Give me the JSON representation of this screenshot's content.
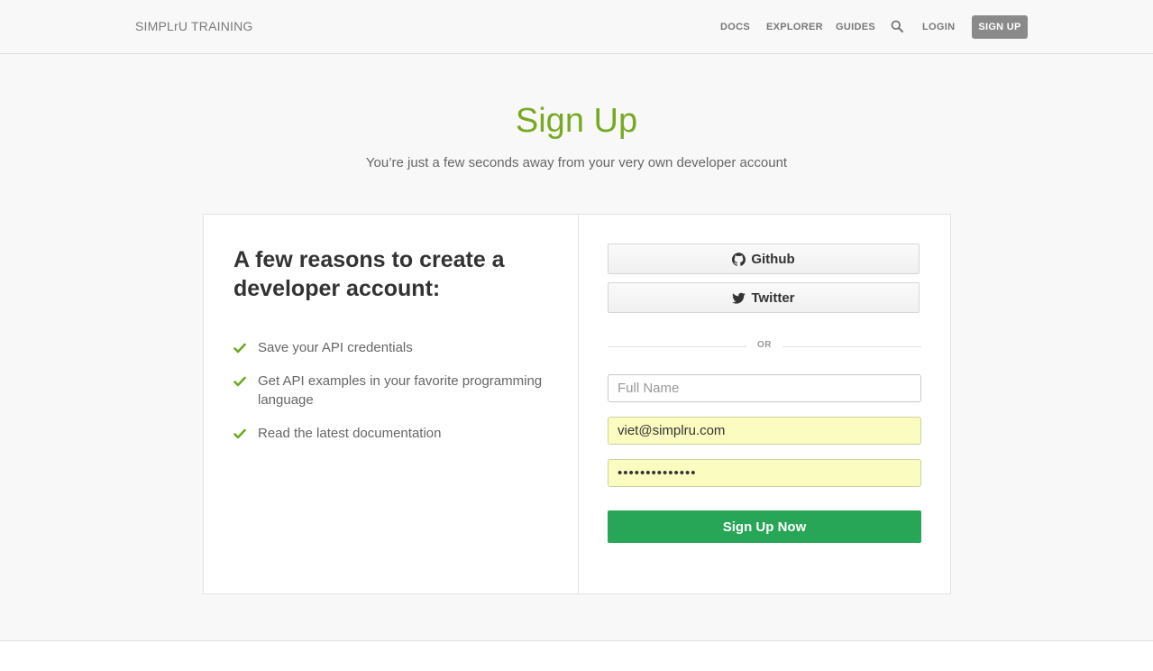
{
  "header": {
    "brand": "SIMPLrU TRAINING",
    "nav": {
      "docs": "DOCS",
      "explorer": "EXPLORER",
      "guides": "GUIDES",
      "search_icon": "search-icon",
      "login": "LOGIN",
      "signup": "SIGN UP"
    }
  },
  "hero": {
    "title": "Sign Up",
    "subtitle": "You’re just a few seconds away from your very own developer account"
  },
  "reasons": {
    "title": "A few reasons to create a developer account:",
    "items": [
      "Save your API credentials",
      "Get API examples in your favorite programming language",
      "Read the latest documentation"
    ]
  },
  "form": {
    "github_label": "Github",
    "twitter_label": "Twitter",
    "or_label": "OR",
    "name_placeholder": "Full Name",
    "name_value": "",
    "email_value": "viet@simplru.com",
    "password_value": "••••••••••••••",
    "submit_label": "Sign Up Now"
  },
  "colors": {
    "accent": "#77aa22",
    "submit": "#27a657",
    "autofill": "#fbfcc0"
  }
}
